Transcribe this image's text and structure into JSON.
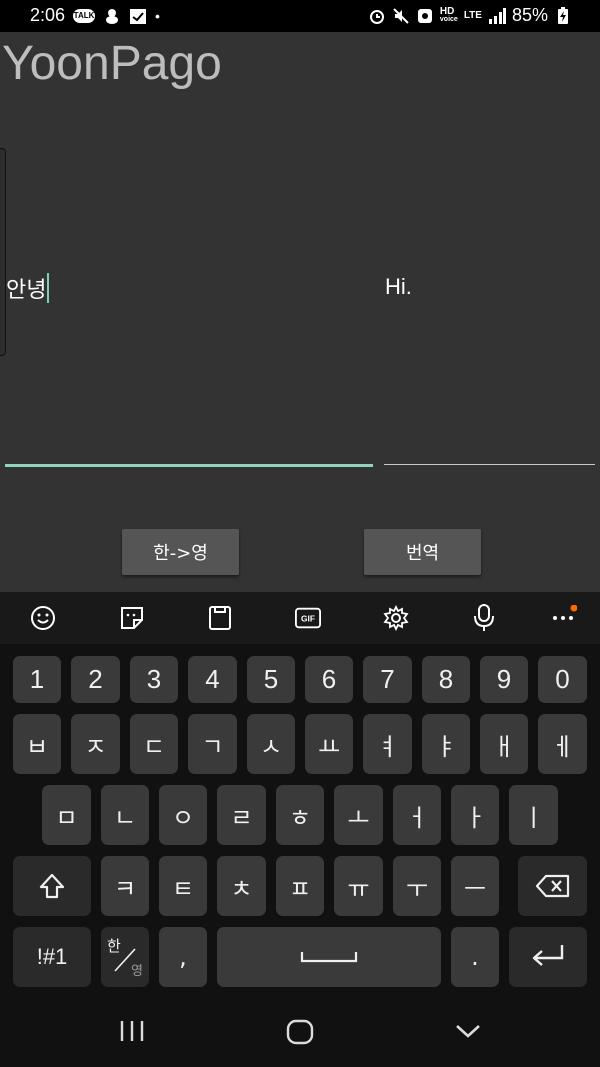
{
  "status": {
    "time": "2:06",
    "left_icons": [
      "talk-icon",
      "bear-icon",
      "calendar-check-icon"
    ],
    "dot": "•",
    "hd": "HD",
    "voice": "voice",
    "lte": "LTE",
    "battery": "85%"
  },
  "app": {
    "title": "YoonPago",
    "input_value": "안녕",
    "output_value": "Hi.",
    "lang_button": "한->영",
    "translate_button": "번역"
  },
  "keyboard": {
    "row_numbers": [
      "1",
      "2",
      "3",
      "4",
      "5",
      "6",
      "7",
      "8",
      "9",
      "0"
    ],
    "row1": [
      "ㅂ",
      "ㅈ",
      "ㄷ",
      "ㄱ",
      "ㅅ",
      "ㅛ",
      "ㅕ",
      "ㅑ",
      "ㅐ",
      "ㅔ"
    ],
    "row2": [
      "ㅁ",
      "ㄴ",
      "ㅇ",
      "ㄹ",
      "ㅎ",
      "ㅗ",
      "ㅓ",
      "ㅏ",
      "ㅣ"
    ],
    "row3": [
      "ㅋ",
      "ㅌ",
      "ㅊ",
      "ㅍ",
      "ㅠ",
      "ㅜ",
      "ㅡ"
    ],
    "symbols_key": "!#1",
    "lang_key_top": "한",
    "lang_key_bottom": "영",
    "comma": ",",
    "period": "."
  },
  "colors": {
    "background": "#333333",
    "accent_underline": "#8fd3c0",
    "button": "#555555",
    "key": "#3a3a3a",
    "notification_dot": "#ff6a00"
  }
}
